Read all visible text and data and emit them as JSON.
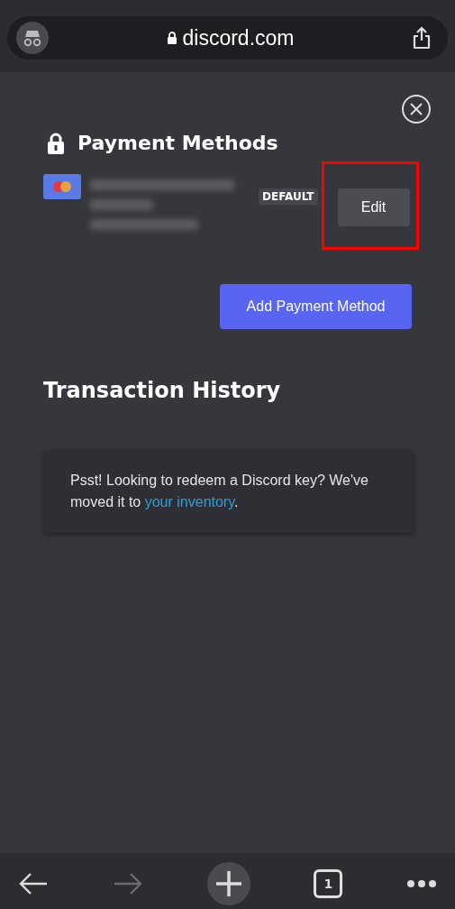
{
  "browser": {
    "url": "discord.com",
    "private_mode": true
  },
  "page": {
    "title": "Payment Methods",
    "payment_methods": [
      {
        "badge": "DEFAULT",
        "edit_label": "Edit",
        "highlighted": true
      }
    ],
    "add_button": "Add Payment Method",
    "history_title": "Transaction History",
    "notice": {
      "text": "Psst! Looking to redeem a Discord key? We've moved it to ",
      "link": "your inventory",
      "tail": "."
    }
  },
  "toolbar": {
    "back_disabled": false,
    "forward_disabled": true,
    "tab_count": "1"
  }
}
